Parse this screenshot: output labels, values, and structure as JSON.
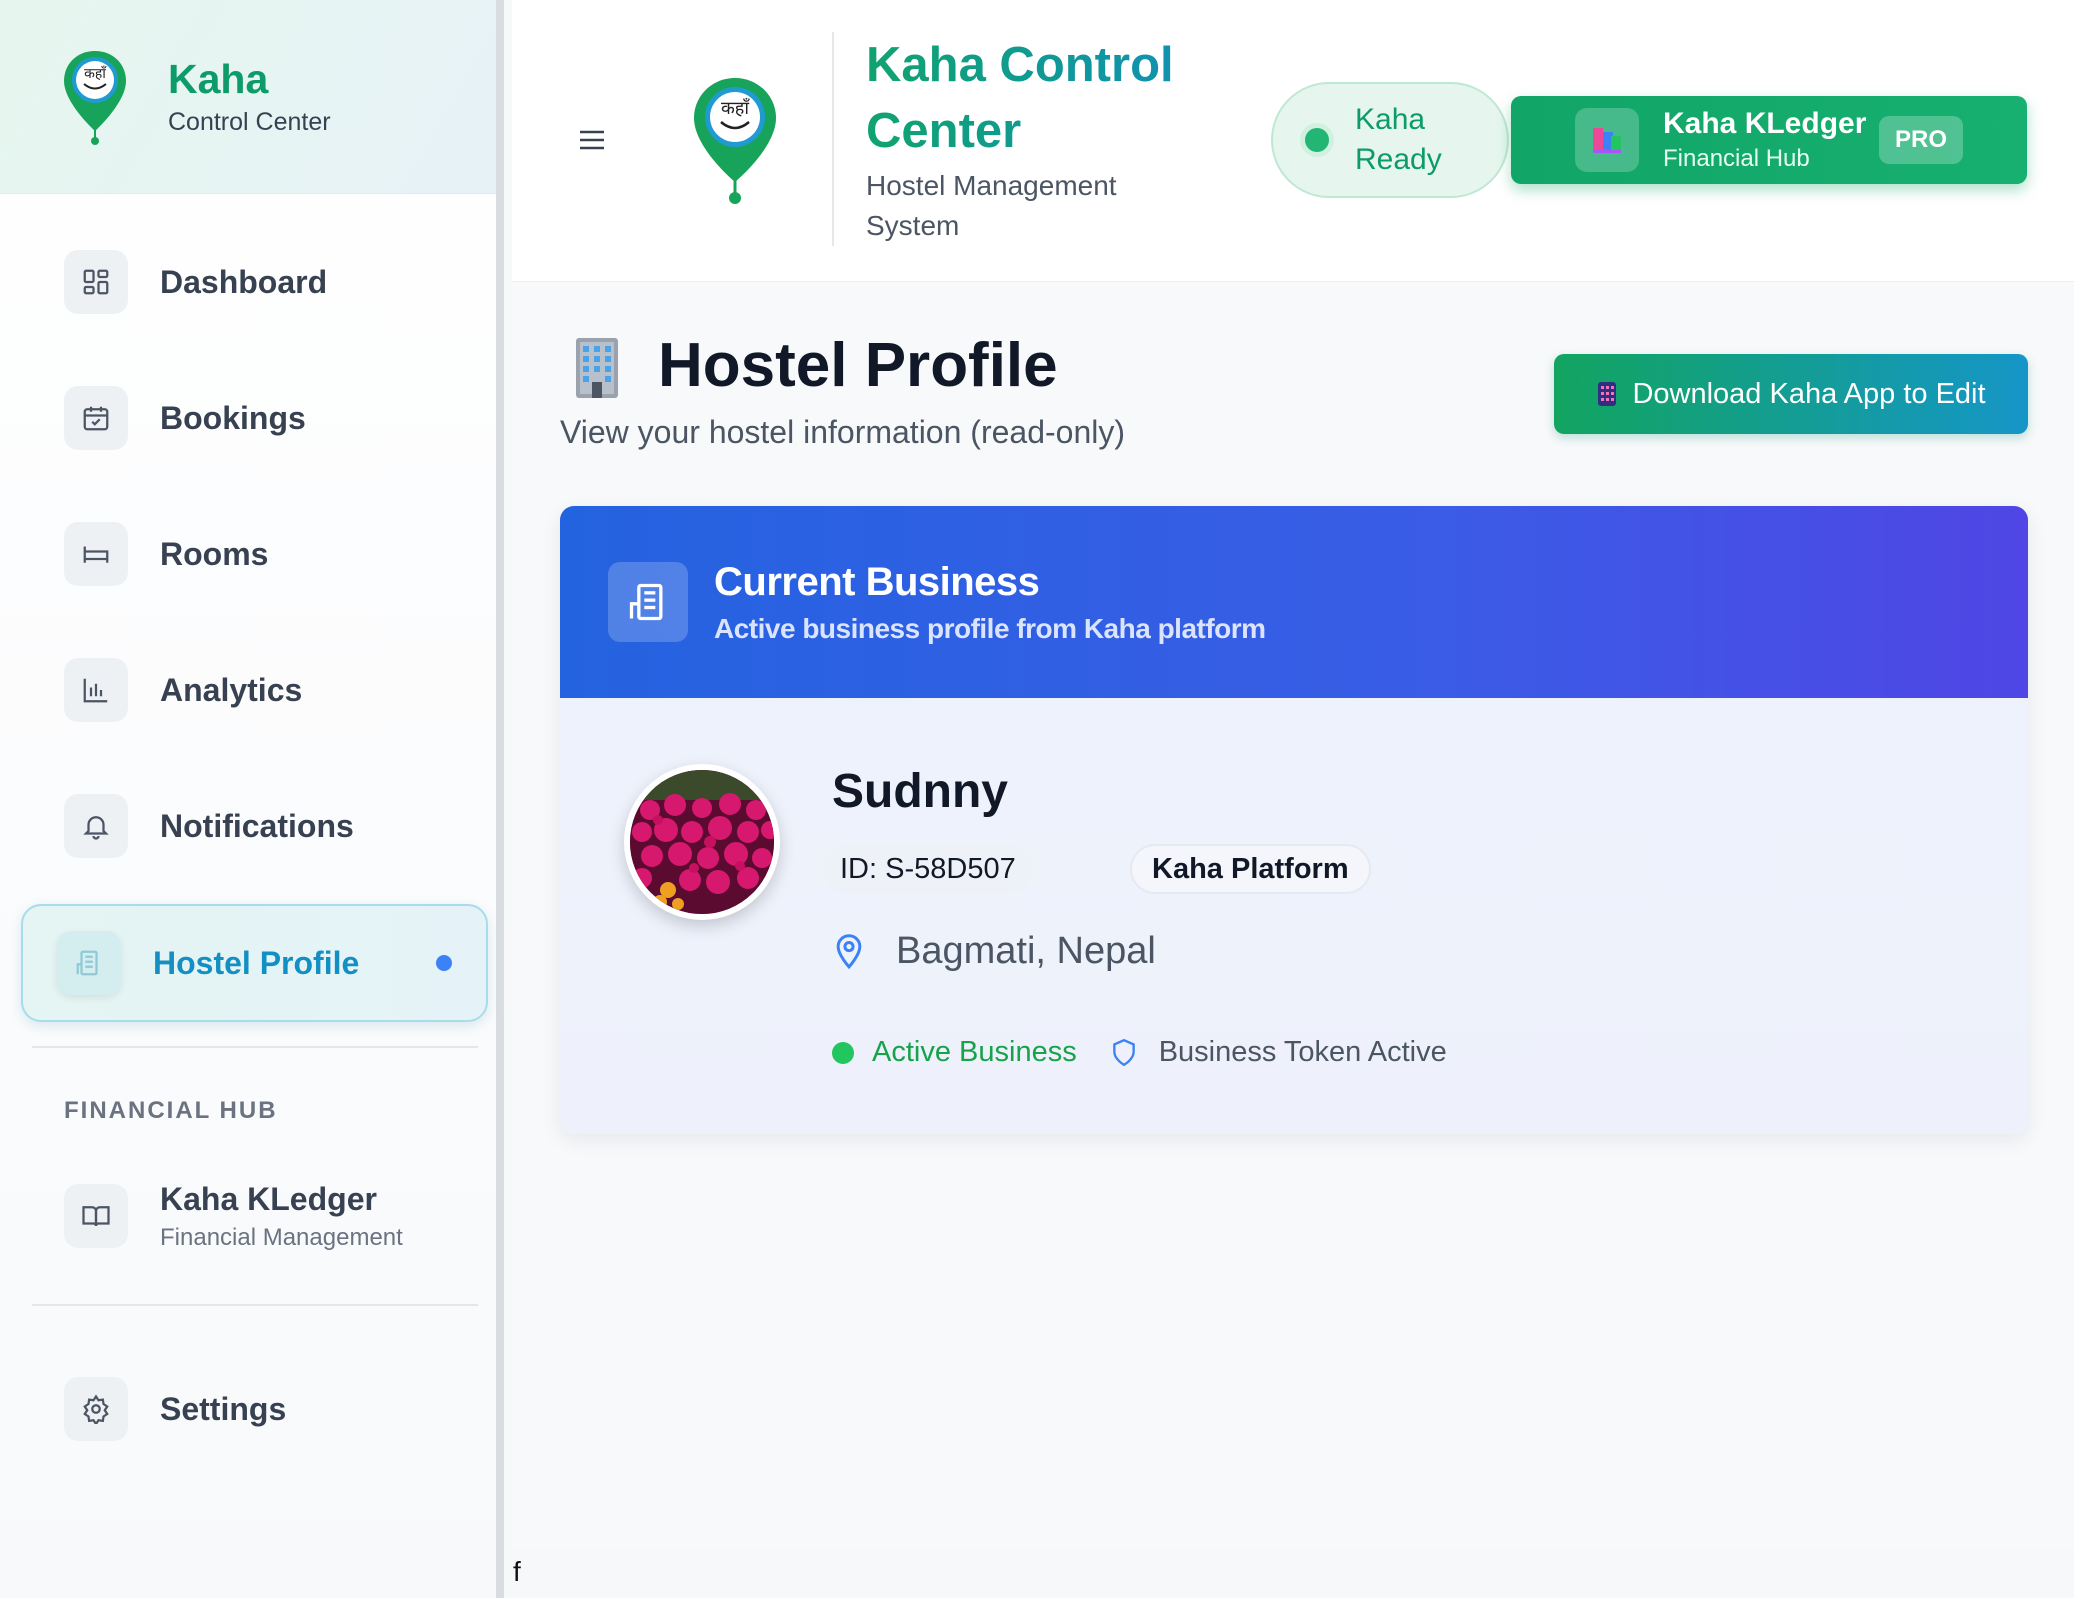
{
  "brand": {
    "title": "Kaha",
    "subtitle": "Control Center",
    "logo_text": "कहाँ"
  },
  "sidebar": {
    "items": [
      {
        "label": "Dashboard",
        "icon": "dashboard-icon"
      },
      {
        "label": "Bookings",
        "icon": "calendar-icon"
      },
      {
        "label": "Rooms",
        "icon": "bed-icon"
      },
      {
        "label": "Analytics",
        "icon": "bar-chart-icon"
      },
      {
        "label": "Notifications",
        "icon": "bell-icon"
      },
      {
        "label": "Hostel Profile",
        "icon": "building-icon",
        "active": true
      }
    ],
    "section_label": "FINANCIAL HUB",
    "kledger": {
      "label": "Kaha KLedger",
      "sub": "Financial Management",
      "icon": "book-open-icon"
    },
    "settings": {
      "label": "Settings",
      "icon": "gear-icon"
    }
  },
  "header": {
    "title": "Kaha Control Center",
    "subtitle": "Hostel Management System",
    "status": "Kaha Ready",
    "kledger_button": {
      "title": "Kaha KLedger",
      "sub": "Financial Hub",
      "badge": "PRO"
    }
  },
  "page": {
    "title": "Hostel Profile",
    "subtitle": "View your hostel information (read-only)",
    "download_button": "Download Kaha App to Edit"
  },
  "business_card": {
    "header_title": "Current Business",
    "header_sub": "Active business profile from Kaha platform",
    "name": "Sudnny",
    "id_label": "ID: S-58D507",
    "platform": "Kaha Platform",
    "location": "Bagmati, Nepal",
    "status_active": "Active Business",
    "token_status": "Business Token Active"
  },
  "footer_text": "f",
  "colors": {
    "brand_green": "#0d9b6a",
    "accent_blue": "#138fc4",
    "card_header_start": "#2463e0",
    "card_header_end": "#4f46e5",
    "active_green": "#16a34a"
  }
}
